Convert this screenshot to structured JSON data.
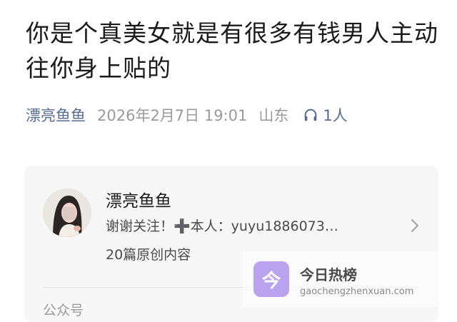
{
  "article": {
    "title": "你是个真美女就是有很多有钱男人主动往你身上贴的",
    "author": "漂亮鱼鱼",
    "date": "2026年2月7日 19:01",
    "region": "山东",
    "listen_count": "1人",
    "listen_icon": "headphones-icon"
  },
  "account_card": {
    "name": "漂亮鱼鱼",
    "description": "谢谢关注！➕本人：yuyu1886073…",
    "article_count": "20篇原创内容",
    "type_label": "公众号",
    "chevron_icon": "chevron-right-icon"
  },
  "watermark": {
    "name": "今日热榜",
    "domain": "gaochengzhenxuan.com",
    "icon_text": "今",
    "icon_color": "#b9a3ee"
  },
  "colors": {
    "link_blue": "#576b95",
    "meta_gray": "#9a9a9a",
    "card_bg": "#f7f7f7"
  }
}
